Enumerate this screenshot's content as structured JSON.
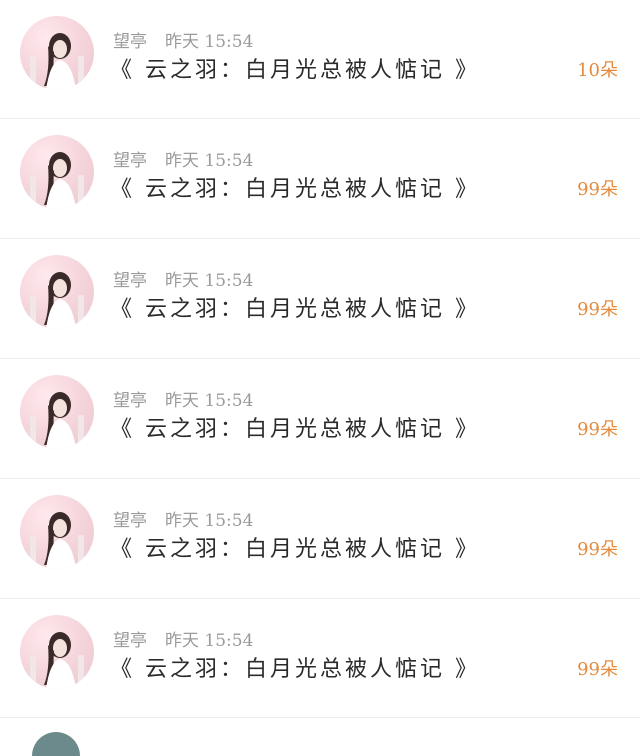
{
  "colors": {
    "gift_orange": "#e58b3e",
    "meta_gray": "#9a9a9a",
    "title_dark": "#2b2b2b",
    "divider": "#eeeeee"
  },
  "entries": [
    {
      "username": "望亭",
      "time": "昨天 15:54",
      "title": "《 云之羽：白月光总被人惦记 》",
      "gift": "10朵",
      "avatar_icon": "user-avatar-icon"
    },
    {
      "username": "望亭",
      "time": "昨天 15:54",
      "title": "《 云之羽：白月光总被人惦记 》",
      "gift": "99朵",
      "avatar_icon": "user-avatar-icon"
    },
    {
      "username": "望亭",
      "time": "昨天 15:54",
      "title": "《 云之羽：白月光总被人惦记 》",
      "gift": "99朵",
      "avatar_icon": "user-avatar-icon"
    },
    {
      "username": "望亭",
      "time": "昨天 15:54",
      "title": "《 云之羽：白月光总被人惦记 》",
      "gift": "99朵",
      "avatar_icon": "user-avatar-icon"
    },
    {
      "username": "望亭",
      "time": "昨天 15:54",
      "title": "《 云之羽：白月光总被人惦记 》",
      "gift": "99朵",
      "avatar_icon": "user-avatar-icon"
    },
    {
      "username": "望亭",
      "time": "昨天 15:54",
      "title": "《 云之羽：白月光总被人惦记 》",
      "gift": "99朵",
      "avatar_icon": "user-avatar-icon"
    }
  ]
}
